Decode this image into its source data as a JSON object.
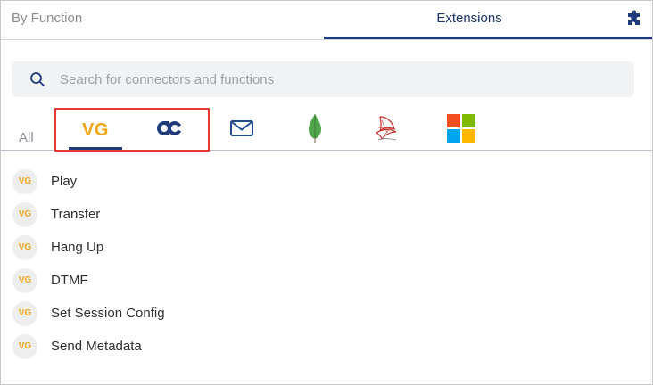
{
  "tabs": {
    "by_function": "By Function",
    "extensions": "Extensions",
    "active": "Extensions"
  },
  "icons": {
    "extensions": "puzzle-icon",
    "search": "search-icon"
  },
  "search": {
    "placeholder": "Search for connectors and functions",
    "value": ""
  },
  "connectors": {
    "all_label": "All",
    "selected": "VG",
    "items": [
      {
        "name": "vg-icon",
        "label": "VG"
      },
      {
        "name": "ac-icon"
      },
      {
        "name": "mail-icon"
      },
      {
        "name": "mongodb-icon"
      },
      {
        "name": "sql-server-icon"
      },
      {
        "name": "microsoft-icon"
      }
    ]
  },
  "functions": {
    "badge": "VG",
    "items": [
      "Play",
      "Transfer",
      "Hang Up",
      "DTMF",
      "Set Session Config",
      "Send Metadata"
    ]
  },
  "colors": {
    "accent_navy": "#1f3a7a",
    "vg_orange": "#f2a516",
    "highlight_red": "#e53935"
  }
}
